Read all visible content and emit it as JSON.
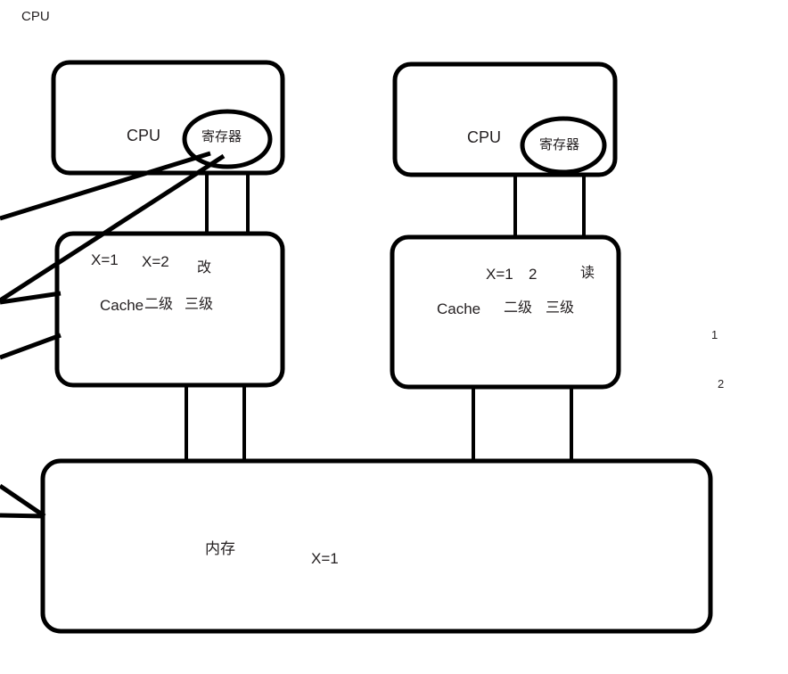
{
  "diagram": {
    "title": "CPU",
    "left_unit": {
      "cpu_box": {
        "label": "CPU",
        "register": {
          "label": "寄存器"
        }
      },
      "cache_box": {
        "value_old": "X=1",
        "value_new": "X=2",
        "operation": "改",
        "level1": "Cache",
        "level2": "二级",
        "level3": "三级"
      }
    },
    "right_unit": {
      "cpu_box": {
        "label": "CPU",
        "register": {
          "label": "寄存器"
        }
      },
      "cache_box": {
        "value": "X=1",
        "value_extra": "2",
        "operation": "读",
        "level1": "Cache",
        "level2": "二级",
        "level3": "三级"
      }
    },
    "memory_box": {
      "label": "内存",
      "value": "X=1"
    },
    "step_markers": [
      {
        "label": "1"
      },
      {
        "label": "2"
      }
    ],
    "colors": {
      "stroke": "#000000",
      "text": "#231f20",
      "background": "#ffffff"
    }
  }
}
